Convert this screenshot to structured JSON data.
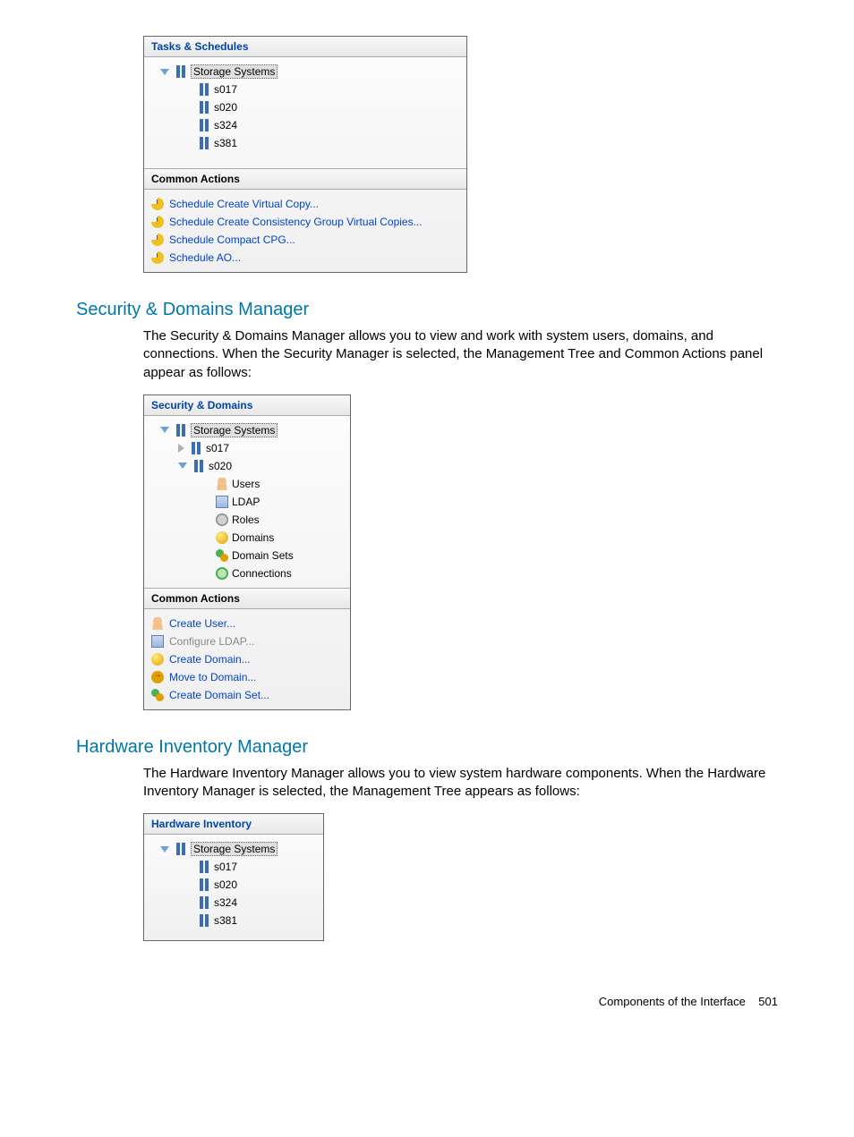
{
  "panel1": {
    "header": "Tasks & Schedules",
    "root": "Storage Systems",
    "nodes": [
      "s017",
      "s020",
      "s324",
      "s381"
    ],
    "common_header": "Common Actions",
    "actions": [
      "Schedule Create Virtual Copy...",
      "Schedule Create Consistency Group Virtual Copies...",
      "Schedule Compact CPG...",
      "Schedule AO..."
    ]
  },
  "section1": {
    "title": "Security & Domains Manager",
    "text": "The Security & Domains Manager allows you to view and work with system users, domains, and connections. When the Security Manager is selected, the Management Tree and Common Actions panel appear as follows:"
  },
  "panel2": {
    "header": "Security & Domains",
    "root": "Storage Systems",
    "node_collapsed": "s017",
    "node_expanded": "s020",
    "children": [
      "Users",
      "LDAP",
      "Roles",
      "Domains",
      "Domain Sets",
      "Connections"
    ],
    "common_header": "Common Actions",
    "actions": [
      {
        "label": "Create User...",
        "disabled": false
      },
      {
        "label": "Configure LDAP...",
        "disabled": true
      },
      {
        "label": "Create Domain...",
        "disabled": false
      },
      {
        "label": "Move to Domain...",
        "disabled": false
      },
      {
        "label": "Create Domain Set...",
        "disabled": false
      }
    ]
  },
  "section2": {
    "title": "Hardware Inventory Manager",
    "text": "The Hardware Inventory Manager allows you to view system hardware components. When the Hardware Inventory Manager is selected, the Management Tree appears as follows:"
  },
  "panel3": {
    "header": "Hardware Inventory",
    "root": "Storage Systems",
    "nodes": [
      "s017",
      "s020",
      "s324",
      "s381"
    ]
  },
  "footer": {
    "text": "Components of the Interface",
    "page": "501"
  }
}
